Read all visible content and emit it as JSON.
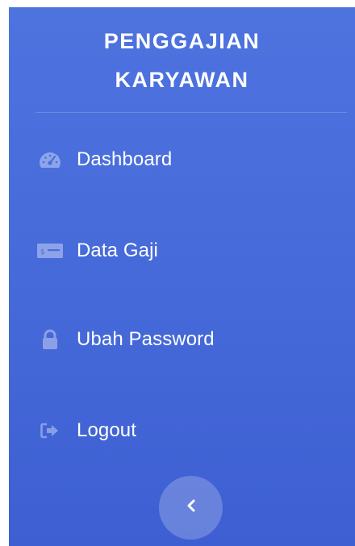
{
  "sidebar": {
    "brand": {
      "line1": "PENGGAJIAN",
      "line2": "KARYAWAN"
    },
    "items": [
      {
        "label": "Dashboard",
        "icon": "tachometer-icon"
      },
      {
        "label": "Data Gaji",
        "icon": "money-bill-icon"
      },
      {
        "label": "Ubah Password",
        "icon": "lock-icon"
      },
      {
        "label": "Logout",
        "icon": "sign-out-icon"
      }
    ],
    "toggle_icon": "chevron-left-icon",
    "colors": {
      "background_top": "#4e73df",
      "background_bottom": "#3d5fd2",
      "text": "#ffffff"
    }
  }
}
